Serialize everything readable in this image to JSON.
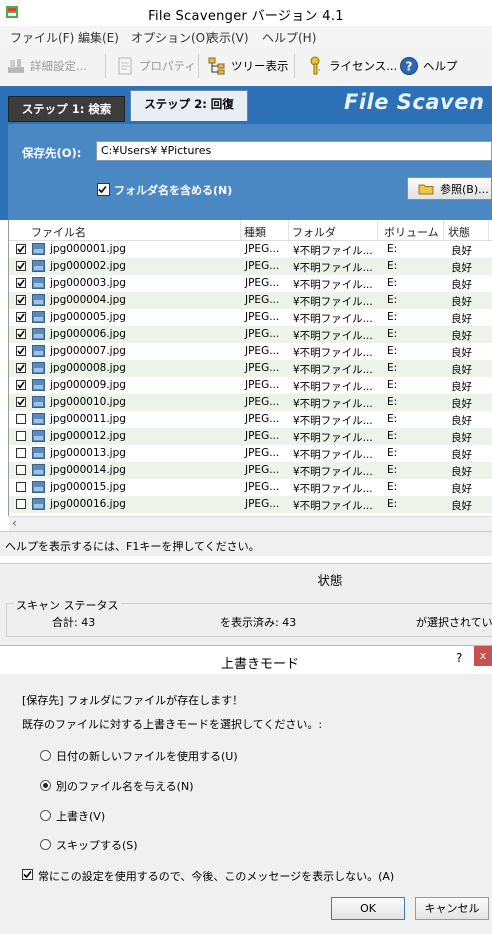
{
  "window": {
    "title": "File Scavenger バージョン 4.1"
  },
  "menu": [
    "ファイル(F)",
    "編集(E)",
    "オプション(O)",
    "表示(V)",
    "ヘルプ(H)"
  ],
  "toolbar": {
    "details": "詳細設定...",
    "properties": "プロパティ",
    "tree_view": "ツリー表示",
    "license": "ライセンス...",
    "help": "ヘルプ"
  },
  "tabs": {
    "step1": "ステップ 1: 検索",
    "step2": "ステップ 2: 回復"
  },
  "brand": "File Scaven",
  "save": {
    "label": "保存先(O):",
    "path": "C:¥Users¥           ¥Pictures"
  },
  "include_folder": {
    "label": "フォルダ名を含める(N)",
    "checked": true
  },
  "browse_label": "参照(B)...",
  "table": {
    "columns": [
      "ファイル名",
      "種類",
      "フォルダ",
      "ボリューム",
      "状態"
    ],
    "rows": [
      {
        "name": "jpg000001.jpg",
        "type": "JPEG...",
        "folder": "¥不明ファイル...",
        "volume": "E:",
        "state": "良好",
        "checked": true
      },
      {
        "name": "jpg000002.jpg",
        "type": "JPEG...",
        "folder": "¥不明ファイル...",
        "volume": "E:",
        "state": "良好",
        "checked": true
      },
      {
        "name": "jpg000003.jpg",
        "type": "JPEG...",
        "folder": "¥不明ファイル...",
        "volume": "E:",
        "state": "良好",
        "checked": true
      },
      {
        "name": "jpg000004.jpg",
        "type": "JPEG...",
        "folder": "¥不明ファイル...",
        "volume": "E:",
        "state": "良好",
        "checked": true
      },
      {
        "name": "jpg000005.jpg",
        "type": "JPEG...",
        "folder": "¥不明ファイル...",
        "volume": "E:",
        "state": "良好",
        "checked": true
      },
      {
        "name": "jpg000006.jpg",
        "type": "JPEG...",
        "folder": "¥不明ファイル...",
        "volume": "E:",
        "state": "良好",
        "checked": true
      },
      {
        "name": "jpg000007.jpg",
        "type": "JPEG...",
        "folder": "¥不明ファイル...",
        "volume": "E:",
        "state": "良好",
        "checked": true
      },
      {
        "name": "jpg000008.jpg",
        "type": "JPEG...",
        "folder": "¥不明ファイル...",
        "volume": "E:",
        "state": "良好",
        "checked": true
      },
      {
        "name": "jpg000009.jpg",
        "type": "JPEG...",
        "folder": "¥不明ファイル...",
        "volume": "E:",
        "state": "良好",
        "checked": true
      },
      {
        "name": "jpg000010.jpg",
        "type": "JPEG...",
        "folder": "¥不明ファイル...",
        "volume": "E:",
        "state": "良好",
        "checked": true
      },
      {
        "name": "jpg000011.jpg",
        "type": "JPEG...",
        "folder": "¥不明ファイル...",
        "volume": "E:",
        "state": "良好",
        "checked": false
      },
      {
        "name": "jpg000012.jpg",
        "type": "JPEG...",
        "folder": "¥不明ファイル...",
        "volume": "E:",
        "state": "良好",
        "checked": false
      },
      {
        "name": "jpg000013.jpg",
        "type": "JPEG...",
        "folder": "¥不明ファイル...",
        "volume": "E:",
        "state": "良好",
        "checked": false
      },
      {
        "name": "jpg000014.jpg",
        "type": "JPEG...",
        "folder": "¥不明ファイル...",
        "volume": "E:",
        "state": "良好",
        "checked": false
      },
      {
        "name": "jpg000015.jpg",
        "type": "JPEG...",
        "folder": "¥不明ファイル...",
        "volume": "E:",
        "state": "良好",
        "checked": false
      },
      {
        "name": "jpg000016.jpg",
        "type": "JPEG...",
        "folder": "¥不明ファイル...",
        "volume": "E:",
        "state": "良好",
        "checked": false
      }
    ]
  },
  "statusbar": "ヘルプを表示するには、F1キーを押してください。",
  "state_panel": {
    "title": "状態",
    "legend": "スキャン ステータス",
    "total": "合計:  43",
    "shown": "を表示済み: 43",
    "selected": "が選択されてい"
  },
  "dialog": {
    "title": "上書きモード",
    "help": "?",
    "close": "x",
    "line1": "[保存先] フォルダにファイルが存在します！",
    "line2": "既存のファイルに対する上書きモードを選択してください。:",
    "options": [
      {
        "label": "日付の新しいファイルを使用する(U)",
        "selected": false
      },
      {
        "label": "別のファイル名を与える(N)",
        "selected": true
      },
      {
        "label": "上書き(V)",
        "selected": false
      },
      {
        "label": "スキップする(S)",
        "selected": false
      }
    ],
    "always": "常にこの設定を使用するので、今後、このメッセージを表示しない。(A)",
    "ok": "OK",
    "cancel": "キャンセル"
  }
}
